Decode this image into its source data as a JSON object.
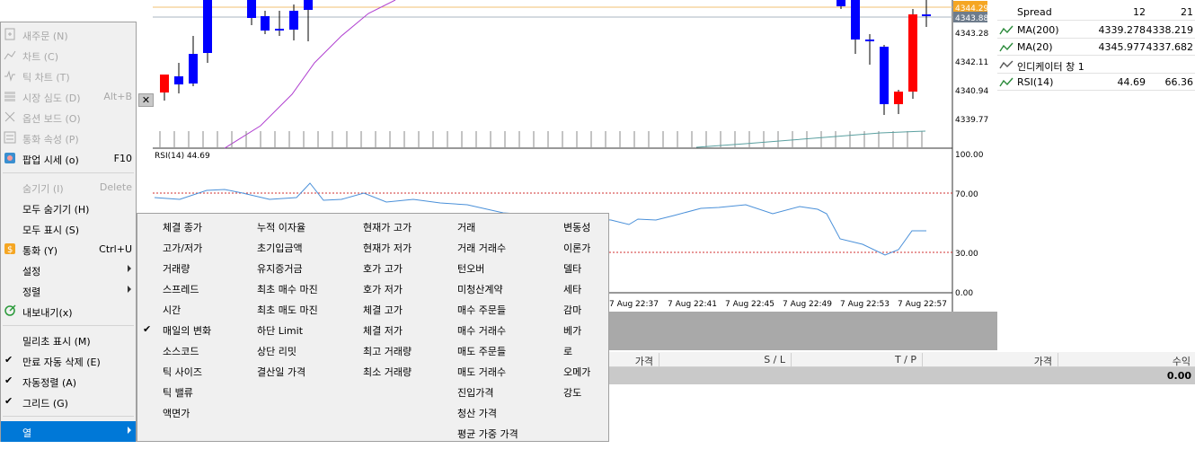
{
  "chart": {
    "price_labels": [
      "4344.29",
      "4343.88",
      "4343.28",
      "4342.11",
      "4340.94",
      "4339.77"
    ],
    "rsi_title": "RSI(14) 44.69",
    "rsi_labels": [
      "100.00",
      "70.00",
      "30.00",
      "0.00"
    ],
    "time_labels": [
      "7 Aug 22:37",
      "7 Aug 22:41",
      "7 Aug 22:45",
      "7 Aug 22:49",
      "7 Aug 22:53",
      "7 Aug 22:57"
    ],
    "colors": {
      "bull": "#ff0000",
      "bear": "#0000ff",
      "ma": "#b040d0",
      "rsi": "#4a90d9",
      "level": "#d03030",
      "ask_bg": "#f5a623",
      "bid_bg": "#6e7c8c"
    }
  },
  "market_watch": {
    "rows": [
      {
        "name": "Spread",
        "v1": "12",
        "v2": "21",
        "icon": "none"
      },
      {
        "name": "MA(200)",
        "v1": "4339.278",
        "v2": "4338.219",
        "icon": "indicator-icon"
      },
      {
        "name": "MA(20)",
        "v1": "4345.977",
        "v2": "4337.682",
        "icon": "indicator-icon"
      },
      {
        "name": "인디케이터 창 1",
        "v1": "",
        "v2": "",
        "icon": "indicator-window-icon"
      },
      {
        "name": "RSI(14)",
        "v1": "44.69",
        "v2": "66.36",
        "icon": "indicator-icon"
      }
    ]
  },
  "terminal": {
    "headers": [
      "가격",
      "S / L",
      "T / P",
      "가격",
      "수익"
    ],
    "total": "0.00"
  },
  "context_menu": {
    "close_glyph": "✕",
    "items": [
      {
        "label": "새주문 (N)",
        "shortcut": "",
        "disabled": true,
        "icon": "new-order-icon",
        "checked": false,
        "submenu": false
      },
      {
        "label": "차트 (C)",
        "shortcut": "",
        "disabled": true,
        "icon": "chart-icon",
        "checked": false,
        "submenu": false
      },
      {
        "label": "틱 차트 (T)",
        "shortcut": "",
        "disabled": true,
        "icon": "tick-chart-icon",
        "checked": false,
        "submenu": false
      },
      {
        "label": "시장 심도 (D)",
        "shortcut": "Alt+B",
        "disabled": true,
        "icon": "market-depth-icon",
        "checked": false,
        "submenu": false
      },
      {
        "label": "옵션 보드 (O)",
        "shortcut": "",
        "disabled": true,
        "icon": "option-board-icon",
        "checked": false,
        "submenu": false
      },
      {
        "label": "통화 속성 (P)",
        "shortcut": "",
        "disabled": true,
        "icon": "symbol-properties-icon",
        "checked": false,
        "submenu": false
      },
      {
        "label": "팝업 시세 (o)",
        "shortcut": "F10",
        "disabled": false,
        "icon": "popup-prices-icon",
        "checked": false,
        "submenu": false
      },
      {
        "sep": true
      },
      {
        "label": "숨기기 (I)",
        "shortcut": "Delete",
        "disabled": true,
        "icon": "",
        "checked": false,
        "submenu": false
      },
      {
        "label": "모두 숨기기 (H)",
        "shortcut": "",
        "disabled": false,
        "icon": "",
        "checked": false,
        "submenu": false
      },
      {
        "label": "모두 표시 (S)",
        "shortcut": "",
        "disabled": false,
        "icon": "",
        "checked": false,
        "submenu": false
      },
      {
        "label": "통화 (Y)",
        "shortcut": "Ctrl+U",
        "disabled": false,
        "icon": "symbols-icon",
        "checked": false,
        "submenu": false
      },
      {
        "label": "설정",
        "shortcut": "",
        "disabled": false,
        "icon": "",
        "checked": false,
        "submenu": true
      },
      {
        "label": "정렬",
        "shortcut": "",
        "disabled": false,
        "icon": "",
        "checked": false,
        "submenu": true
      },
      {
        "label": "내보내기(x)",
        "shortcut": "",
        "disabled": false,
        "icon": "export-icon",
        "checked": false,
        "submenu": false
      },
      {
        "sep": true
      },
      {
        "label": "밀리초 표시 (M)",
        "shortcut": "",
        "disabled": false,
        "icon": "",
        "checked": false,
        "submenu": false
      },
      {
        "label": "만료 자동 삭제 (E)",
        "shortcut": "",
        "disabled": false,
        "icon": "",
        "checked": true,
        "submenu": false
      },
      {
        "label": "자동정렬 (A)",
        "shortcut": "",
        "disabled": false,
        "icon": "",
        "checked": true,
        "submenu": false
      },
      {
        "label": "그리드 (G)",
        "shortcut": "",
        "disabled": false,
        "icon": "",
        "checked": true,
        "submenu": false
      },
      {
        "sep": true
      },
      {
        "label": "열",
        "shortcut": "",
        "disabled": false,
        "icon": "",
        "checked": false,
        "submenu": true,
        "selected": true
      }
    ]
  },
  "columns_menu": {
    "columns": [
      [
        "체결 종가",
        "고가/저가",
        "거래량",
        "스프레드",
        "시간",
        "매일의 변화",
        "소스코드",
        "틱 사이즈",
        "틱 밸류",
        "액면가"
      ],
      [
        "누적 이자율",
        "초기입금액",
        "유지증거금",
        "최초 매수 마진",
        "최초 매도 마진",
        "하단 Limit",
        "상단 리밋",
        "결산일 가격"
      ],
      [
        "현재가 고가",
        "현재가 저가",
        "호가 고가",
        "호가 저가",
        "체결 고가",
        "체결 저가",
        "최고 거래량",
        "최소 거래량"
      ],
      [
        "거래",
        "거래 거래수",
        "턴오버",
        "미청산계약",
        "매수 주문들",
        "매수 거래수",
        "매도 주문들",
        "매도 거래수",
        "진입가격",
        "청산 가격",
        "평균 가중 가격"
      ],
      [
        "변동성",
        "이론가",
        "델타",
        "세타",
        "감마",
        "베가",
        "로",
        "오메가",
        "강도"
      ]
    ],
    "checked": [
      "매일의 변화"
    ]
  }
}
